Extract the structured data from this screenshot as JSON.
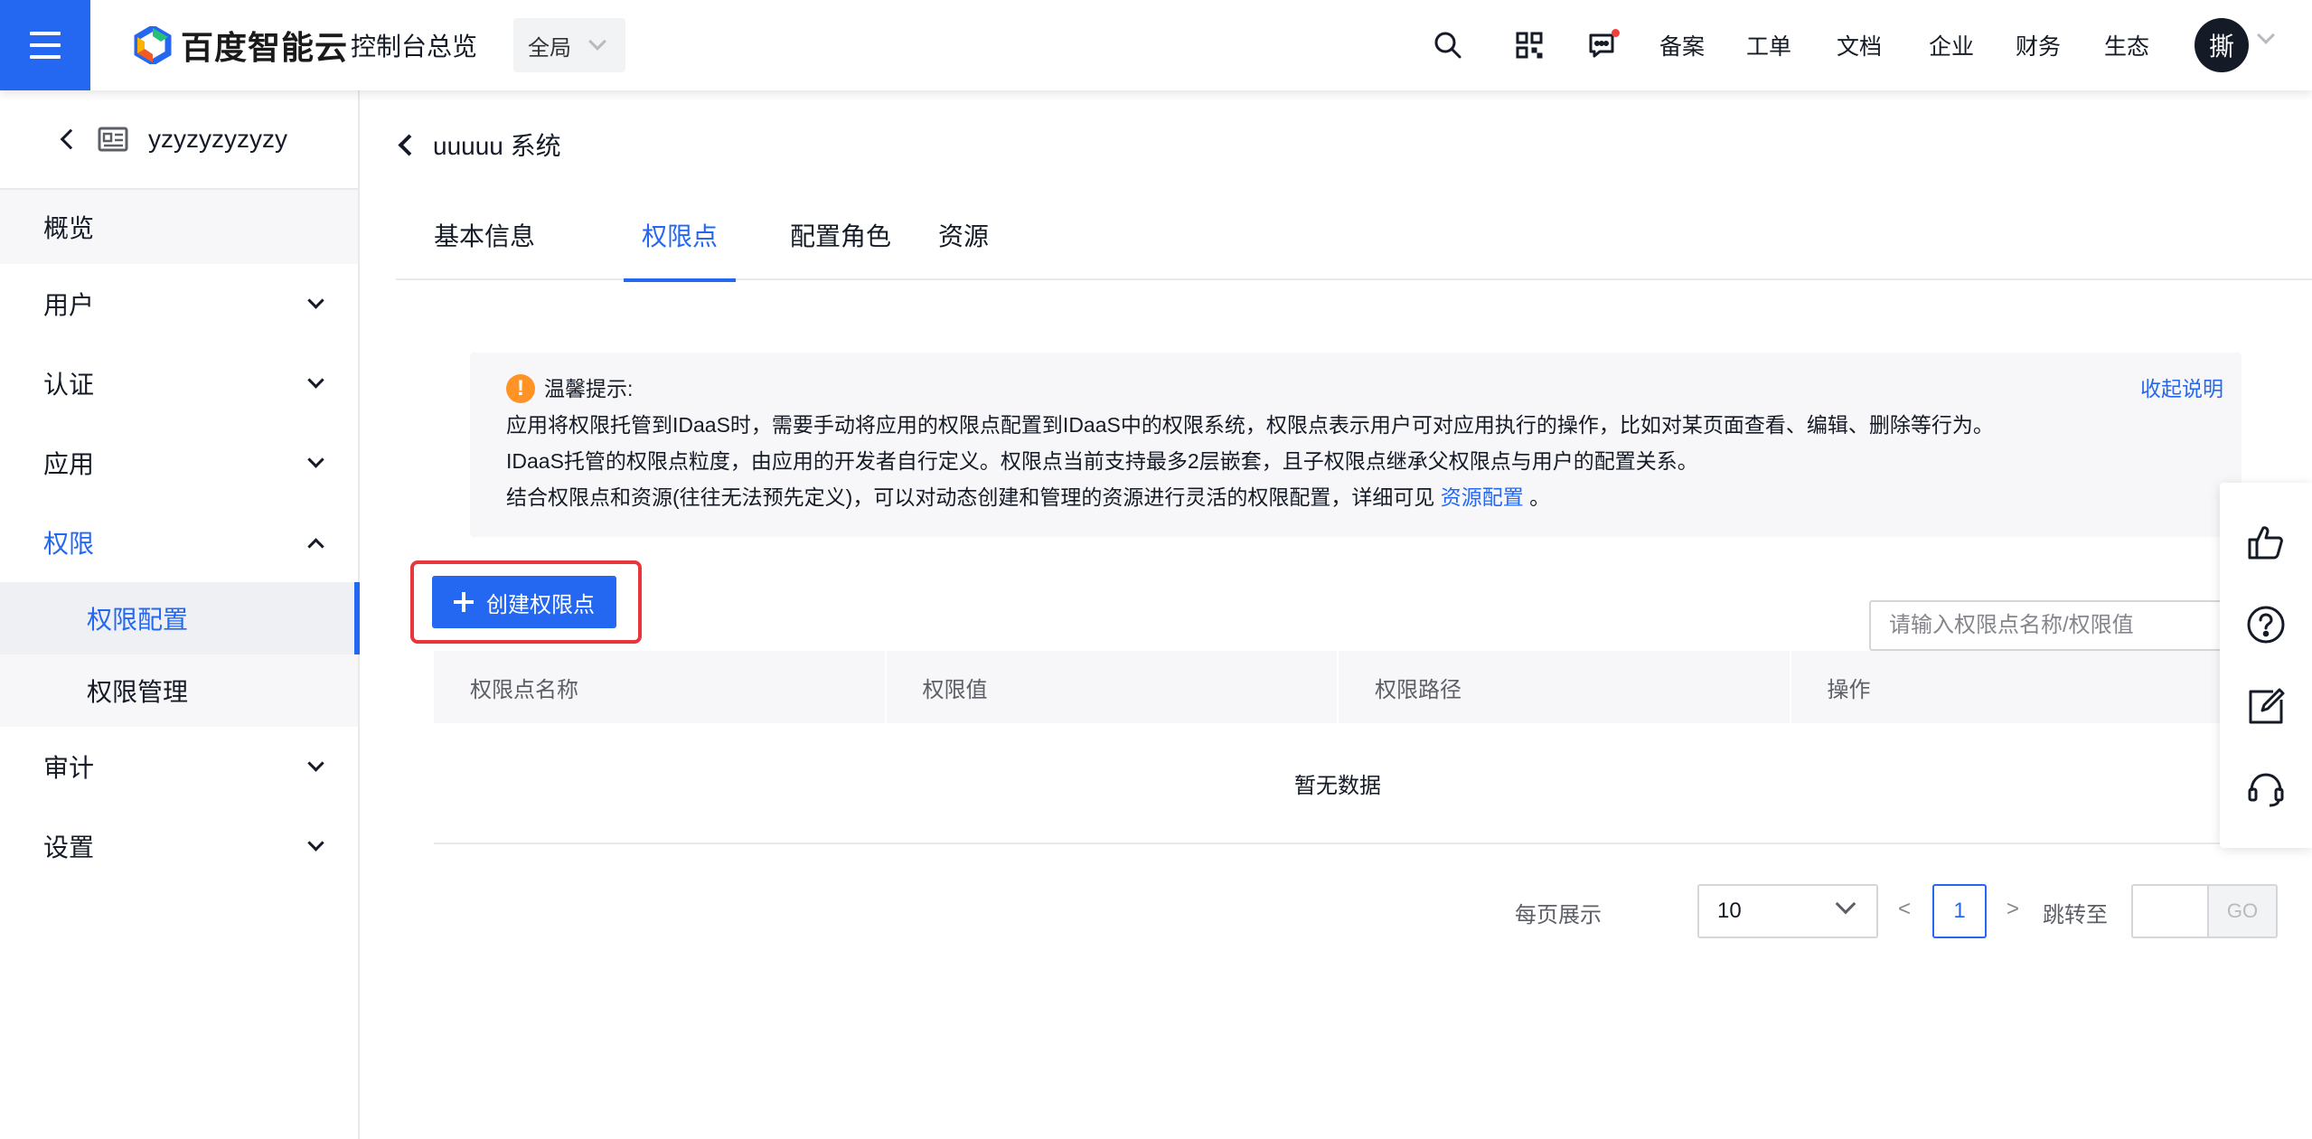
{
  "header": {
    "logo_text": "百度智能云",
    "console_title": "控制台总览",
    "region": "全局",
    "icons": [
      "search-icon",
      "qrcode-icon",
      "message-icon"
    ],
    "links": [
      "备案",
      "工单",
      "文档",
      "企业",
      "财务",
      "生态"
    ],
    "avatar_text": "撕"
  },
  "sidebar": {
    "instance_name": "yzyzyzyzyzy",
    "items": [
      {
        "label": "概览"
      },
      {
        "label": "用户"
      },
      {
        "label": "认证"
      },
      {
        "label": "应用"
      },
      {
        "label": "权限"
      },
      {
        "label": "审计"
      },
      {
        "label": "设置"
      }
    ],
    "subitems": [
      {
        "label": "权限配置"
      },
      {
        "label": "权限管理"
      }
    ]
  },
  "page": {
    "title": "uuuuu 系统",
    "tabs": [
      "基本信息",
      "权限点",
      "配置角色",
      "资源"
    ],
    "active_tab": "权限点"
  },
  "tip": {
    "title": "温馨提示:",
    "collapse": "收起说明",
    "line1": "应用将权限托管到IDaaS时，需要手动将应用的权限点配置到IDaaS中的权限系统，权限点表示用户可对应用执行的操作，比如对某页面查看、编辑、删除等行为。",
    "line2": "IDaaS托管的权限点粒度，由应用的开发者自行定义。权限点当前支持最多2层嵌套，且子权限点继承父权限点与用户的配置关系。",
    "line3_prefix": "结合权限点和资源(往往无法预先定义)，可以对动态创建和管理的资源进行灵活的权限配置，详细可见 ",
    "line3_link": "资源配置",
    "line3_suffix": " 。"
  },
  "toolbar": {
    "create_label": "创建权限点",
    "search_placeholder": "请输入权限点名称/权限值"
  },
  "table": {
    "columns": [
      "权限点名称",
      "权限值",
      "权限路径",
      "操作"
    ],
    "empty_text": "暂无数据"
  },
  "pagination": {
    "page_size_label": "每页展示",
    "page_size": "10",
    "prev": "<",
    "current_page": "1",
    "next": ">",
    "jump_label": "跳转至",
    "go_label": "GO"
  },
  "float_bar": [
    "thumbs-up-icon",
    "help-icon",
    "edit-icon",
    "headset-icon"
  ],
  "colors": {
    "primary": "#2468f2",
    "warning": "#ff9326",
    "highlight_frame": "#e8363c"
  }
}
